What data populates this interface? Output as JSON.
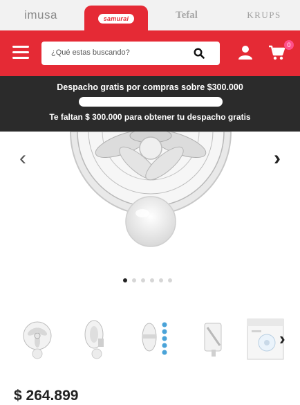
{
  "brands": {
    "items": [
      "imusa",
      "samurai",
      "Tefal",
      "KRUPS"
    ],
    "active": "samurai"
  },
  "search": {
    "placeholder": "¿Qué estas buscando?"
  },
  "cart": {
    "count": "0"
  },
  "promo": {
    "line1": "Despacho gratis por compras sobre $300.000",
    "line2": "Te faltan $ 300.000 para obtener tu despacho gratis",
    "progress_fraction": 0
  },
  "carousel": {
    "prev_glyph": "‹",
    "next_glyph": "›",
    "slide_count": 6,
    "active_index": 0
  },
  "thumbnails": {
    "items": [
      "fan-front",
      "fan-side",
      "fan-colors",
      "fan-mount",
      "fan-box"
    ],
    "next_glyph": "›"
  },
  "product": {
    "price": "$ 264.899"
  },
  "colors": {
    "brand_red": "#e52a35",
    "promo_bg": "#2b2b2b",
    "badge_pink": "#ff4f8b"
  }
}
